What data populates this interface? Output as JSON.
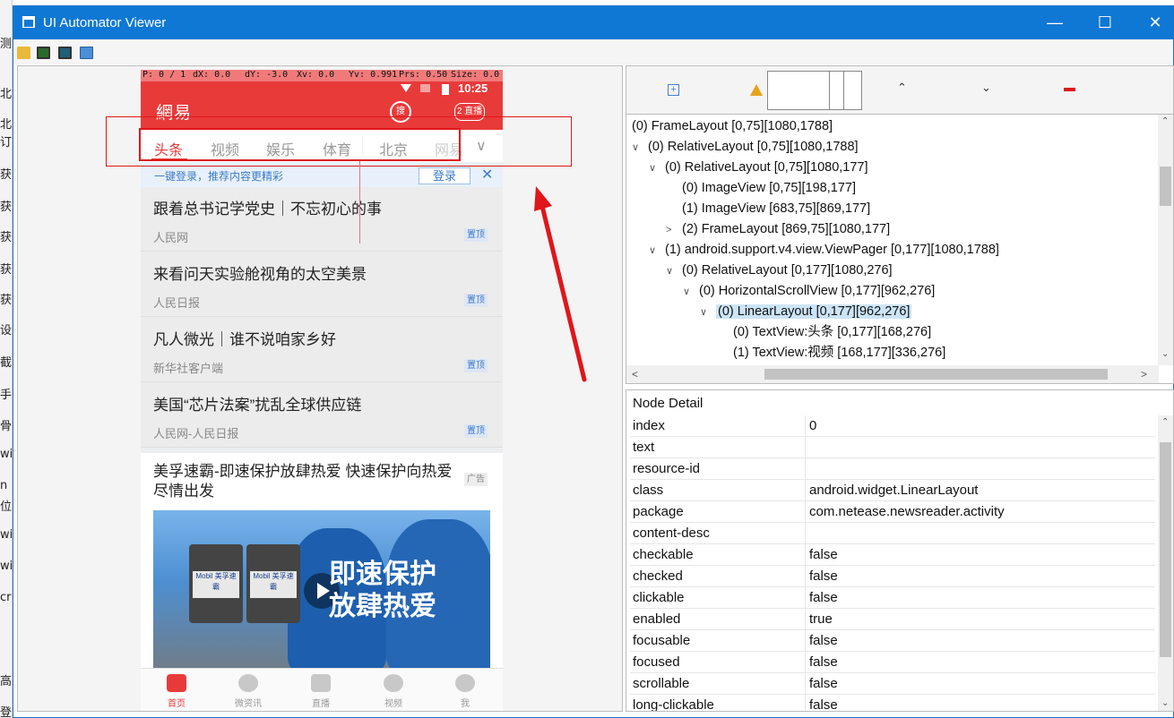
{
  "window": {
    "title": "UI Automator Viewer",
    "minimize": "—",
    "maximize": "☐",
    "close": "✕"
  },
  "toolbar": {
    "icons": [
      "open-folder-icon",
      "device-screenshot-icon",
      "device-screenshot-compressed-icon",
      "save-icon"
    ]
  },
  "device": {
    "debug_bar": {
      "p": "P: 0 / 1",
      "dx": "dX: 0.0",
      "dy": "dY: -3.0",
      "xv": "Xv: 0.0",
      "yv": "Yv: 0.991",
      "prs": "Prs: 0.50",
      "size": "Size: 0.0"
    },
    "status_time": "10:25",
    "logo": "網易",
    "search_label": "搜",
    "live_label": "2 直播",
    "tabs": [
      "头条",
      "视频",
      "娱乐",
      "体育",
      "北京",
      "网易"
    ],
    "login_bar": {
      "text": "一键登录，推荐内容更精彩",
      "button": "登录",
      "close": "✕"
    },
    "news": [
      {
        "headline": "跟着总书记学党史｜不忘初心的事",
        "source": "人民网",
        "badge": "置顶"
      },
      {
        "headline": "来看问天实验舱视角的太空美景",
        "source": "人民日报",
        "badge": "置顶"
      },
      {
        "headline": "凡人微光｜谁不说咱家乡好",
        "source": "新华社客户端",
        "badge": "置顶"
      },
      {
        "headline": "美国“芯片法案”扰乱全球供应链",
        "source": "人民网-人民日报",
        "badge": "置顶"
      }
    ],
    "ad": {
      "title": "美孚速霸-即速保护放肆热爱 快速保护向热爱尽情出发",
      "tag": "广告",
      "slogan_line1": "即速保护",
      "slogan_line2": "放肆热爱",
      "bottle_label_1": "Mobil 美孚速霸",
      "bottle_label_2": "Mobil 美孚速霸"
    },
    "bottom_nav": [
      "首页",
      "微资讯",
      "直播",
      "视频",
      "我"
    ]
  },
  "tree_toolbar": {
    "icons": [
      "expand-all-icon",
      "warning-icon",
      "search-input",
      "previous-icon",
      "next-icon",
      "clear-icon"
    ]
  },
  "tree": [
    {
      "label": "(0) FrameLayout [0,75][1080,1788]",
      "level": 0,
      "twisty": ""
    },
    {
      "label": "(0) RelativeLayout [0,75][1080,1788]",
      "level": 0,
      "twisty": "∨"
    },
    {
      "label": "(0) RelativeLayout [0,75][1080,177]",
      "level": 1,
      "twisty": "∨"
    },
    {
      "label": "(0) ImageView [0,75][198,177]",
      "level": 2,
      "twisty": ""
    },
    {
      "label": "(1) ImageView [683,75][869,177]",
      "level": 2,
      "twisty": ""
    },
    {
      "label": "(2) FrameLayout [869,75][1080,177]",
      "level": 2,
      "twisty": ">"
    },
    {
      "label": "(1) android.support.v4.view.ViewPager [0,177][1080,1788]",
      "level": 1,
      "twisty": "∨"
    },
    {
      "label": "(0) RelativeLayout [0,177][1080,276]",
      "level": 2,
      "twisty": "∨"
    },
    {
      "label": "(0) HorizontalScrollView [0,177][962,276]",
      "level": 3,
      "twisty": "∨"
    },
    {
      "label": "(0) LinearLayout [0,177][962,276]",
      "level": 4,
      "twisty": "∨",
      "selected": true
    },
    {
      "label": "(0) TextView:头条 [0,177][168,276]",
      "level": 5,
      "twisty": ""
    },
    {
      "label": "(1) TextView:视频 [168,177][336,276]",
      "level": 5,
      "twisty": ""
    }
  ],
  "detail": {
    "title": "Node Detail",
    "rows": [
      {
        "k": "index",
        "v": "0"
      },
      {
        "k": "text",
        "v": ""
      },
      {
        "k": "resource-id",
        "v": ""
      },
      {
        "k": "class",
        "v": "android.widget.LinearLayout"
      },
      {
        "k": "package",
        "v": "com.netease.newsreader.activity"
      },
      {
        "k": "content-desc",
        "v": ""
      },
      {
        "k": "checkable",
        "v": "false"
      },
      {
        "k": "checked",
        "v": "false"
      },
      {
        "k": "clickable",
        "v": "false"
      },
      {
        "k": "enabled",
        "v": "true"
      },
      {
        "k": "focusable",
        "v": "false"
      },
      {
        "k": "focused",
        "v": "false"
      },
      {
        "k": "scrollable",
        "v": "false"
      },
      {
        "k": "long-clickable",
        "v": "false"
      }
    ]
  },
  "background": {
    "left_chars": [
      "测",
      "北",
      "北",
      "订",
      "获",
      "获",
      "获",
      "获",
      "获",
      "设",
      "截",
      "手",
      "骨",
      "wi",
      "n",
      "位",
      "wi",
      "wi",
      "cr",
      "高",
      "登"
    ],
    "top_text": "..."
  },
  "colors": {
    "accent": "#0f78d4",
    "app_red": "#e93a3a",
    "selection": "#cce4f7",
    "annotation_red": "#e0161a"
  }
}
